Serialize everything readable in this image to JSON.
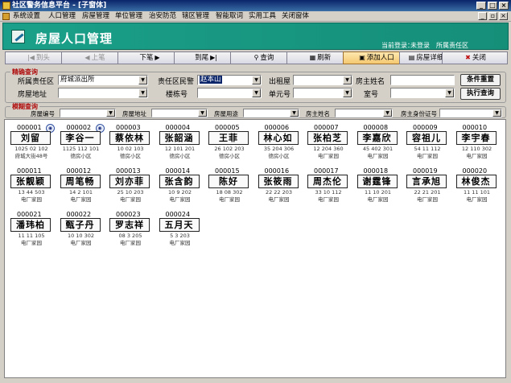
{
  "window": {
    "title": "社区警务信息平台 - [子窗体]",
    "min_label": "_",
    "max_label": "□",
    "close_label": "×"
  },
  "menu": {
    "items": [
      "系统设置",
      "人口管理",
      "房屋管理",
      "单位管理",
      "治安防范",
      "辖区管理",
      "智能取词",
      "实用工具",
      "关闭窗体"
    ],
    "child_controls": [
      "_",
      "▫",
      "×"
    ]
  },
  "header": {
    "title": "房屋人口管理",
    "login_label": "当前登录：",
    "login_user": "未登录",
    "area": "所属责任区"
  },
  "toolbar": {
    "buttons": [
      {
        "label": "到头",
        "icon": "|◀"
      },
      {
        "label": "上笔",
        "icon": "◀"
      },
      {
        "label": "下笔",
        "icon": "▶"
      },
      {
        "label": "到尾",
        "icon": "▶|"
      },
      {
        "label": "查询",
        "icon": "⚲"
      },
      {
        "label": "刷新",
        "icon": "▦"
      },
      {
        "label": "添加人口",
        "icon": "▣"
      },
      {
        "label": "房屋详细信息",
        "icon": "▤"
      },
      {
        "label": "关闭",
        "icon": "✖"
      }
    ]
  },
  "precise": {
    "legend": "精确查询",
    "area_label": "所属责任区",
    "area_value": "府城派出所",
    "officer_label": "责任区民警",
    "officer_value": "赵本山",
    "rent_label": "出租屋",
    "owner_label": "房主姓名",
    "address_label": "房屋地址",
    "building_label": "楼栋号",
    "unit_label": "单元号",
    "room_label": "室号",
    "reset_button": "条件重置",
    "execute_button": "执行查询"
  },
  "fuzzy": {
    "legend": "模糊查询",
    "house_no_label": "房屋编号",
    "address_label": "房屋地址",
    "usage_label": "房屋用途",
    "owner_label": "房主姓名",
    "owner_id_label": "房主身份证号"
  },
  "cards": [
    {
      "id": "000001",
      "name": "刘留",
      "num": "1025 02 102",
      "addr": "府城大街48号",
      "badge": true
    },
    {
      "id": "000002",
      "name": "李谷一",
      "num": "1125 112 101",
      "addr": "德房小区",
      "badge": true
    },
    {
      "id": "000003",
      "name": "蔡依林",
      "num": "10 02 103",
      "addr": "德房小区",
      "badge": false
    },
    {
      "id": "000004",
      "name": "张韶涵",
      "num": "12 101 201",
      "addr": "德房小区",
      "badge": false
    },
    {
      "id": "000005",
      "name": "王菲",
      "num": "26 102 203",
      "addr": "德房小区",
      "badge": false
    },
    {
      "id": "000006",
      "name": "林心如",
      "num": "35 204 306",
      "addr": "德房小区",
      "badge": false
    },
    {
      "id": "000007",
      "name": "张柏芝",
      "num": "12 204 360",
      "addr": "电厂家园",
      "badge": false
    },
    {
      "id": "000008",
      "name": "李嘉欣",
      "num": "45 402 301",
      "addr": "电厂家园",
      "badge": false
    },
    {
      "id": "000009",
      "name": "容祖儿",
      "num": "54 11 112",
      "addr": "电厂家园",
      "badge": false
    },
    {
      "id": "000010",
      "name": "李宇春",
      "num": "12 110 302",
      "addr": "电厂家园",
      "badge": false
    },
    {
      "id": "000011",
      "name": "张靓颖",
      "num": "13 44 503",
      "addr": "电厂家园",
      "badge": false
    },
    {
      "id": "000012",
      "name": "周笔畅",
      "num": "14 2 101",
      "addr": "电厂家园",
      "badge": false
    },
    {
      "id": "000013",
      "name": "刘亦菲",
      "num": "25 10 203",
      "addr": "电厂家园",
      "badge": false
    },
    {
      "id": "000014",
      "name": "张含韵",
      "num": "10 9 202",
      "addr": "电厂家园",
      "badge": false
    },
    {
      "id": "000015",
      "name": "陈好",
      "num": "18 08 302",
      "addr": "电厂家园",
      "badge": false
    },
    {
      "id": "000016",
      "name": "张筱雨",
      "num": "22 22 203",
      "addr": "电厂家园",
      "badge": false
    },
    {
      "id": "000017",
      "name": "周杰伦",
      "num": "33 10 112",
      "addr": "电厂家园",
      "badge": false
    },
    {
      "id": "000018",
      "name": "谢霆锋",
      "num": "11 10 201",
      "addr": "电厂家园",
      "badge": false
    },
    {
      "id": "000019",
      "name": "言承旭",
      "num": "22 21 201",
      "addr": "电厂家园",
      "badge": false
    },
    {
      "id": "000020",
      "name": "林俊杰",
      "num": "11 11 101",
      "addr": "电厂家园",
      "badge": false
    },
    {
      "id": "000021",
      "name": "潘玮柏",
      "num": "11 11 105",
      "addr": "电厂家园",
      "badge": false
    },
    {
      "id": "000022",
      "name": "甄子丹",
      "num": "10 10 302",
      "addr": "电厂家园",
      "badge": false
    },
    {
      "id": "000023",
      "name": "罗志祥",
      "num": "08 3 205",
      "addr": "电厂家园",
      "badge": false
    },
    {
      "id": "000024",
      "name": "五月天",
      "num": "5 3 203",
      "addr": "电厂家园",
      "badge": false
    }
  ]
}
